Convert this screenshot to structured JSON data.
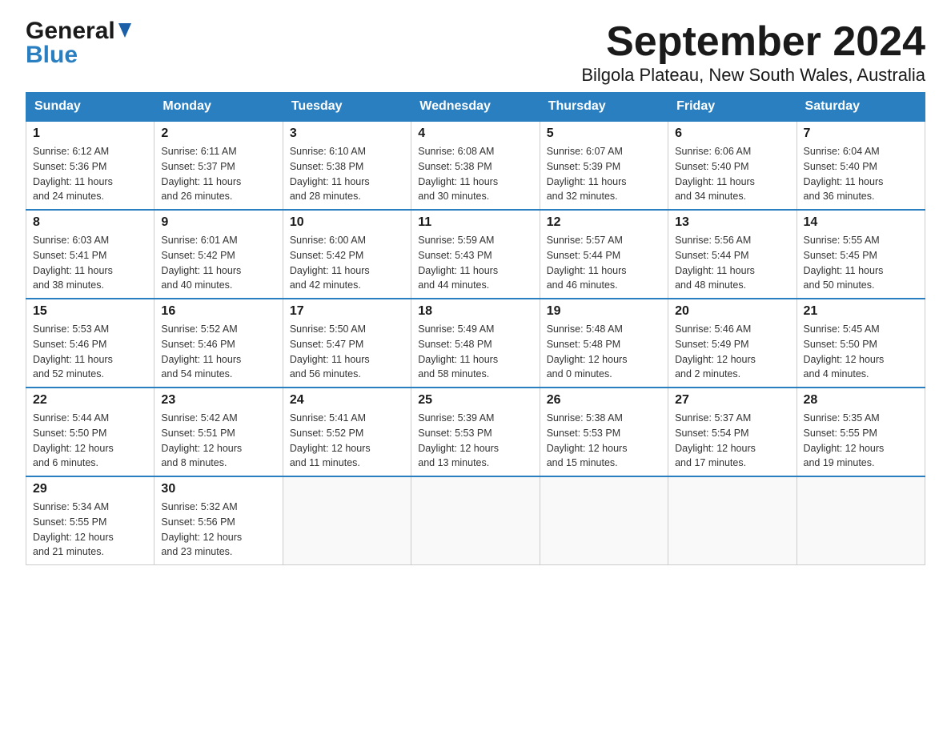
{
  "header": {
    "logo_part1": "General",
    "logo_part2": "Blue",
    "month_title": "September 2024",
    "location": "Bilgola Plateau, New South Wales, Australia"
  },
  "calendar": {
    "days_of_week": [
      "Sunday",
      "Monday",
      "Tuesday",
      "Wednesday",
      "Thursday",
      "Friday",
      "Saturday"
    ],
    "weeks": [
      [
        {
          "day": "1",
          "sunrise": "6:12 AM",
          "sunset": "5:36 PM",
          "daylight": "11 hours and 24 minutes."
        },
        {
          "day": "2",
          "sunrise": "6:11 AM",
          "sunset": "5:37 PM",
          "daylight": "11 hours and 26 minutes."
        },
        {
          "day": "3",
          "sunrise": "6:10 AM",
          "sunset": "5:38 PM",
          "daylight": "11 hours and 28 minutes."
        },
        {
          "day": "4",
          "sunrise": "6:08 AM",
          "sunset": "5:38 PM",
          "daylight": "11 hours and 30 minutes."
        },
        {
          "day": "5",
          "sunrise": "6:07 AM",
          "sunset": "5:39 PM",
          "daylight": "11 hours and 32 minutes."
        },
        {
          "day": "6",
          "sunrise": "6:06 AM",
          "sunset": "5:40 PM",
          "daylight": "11 hours and 34 minutes."
        },
        {
          "day": "7",
          "sunrise": "6:04 AM",
          "sunset": "5:40 PM",
          "daylight": "11 hours and 36 minutes."
        }
      ],
      [
        {
          "day": "8",
          "sunrise": "6:03 AM",
          "sunset": "5:41 PM",
          "daylight": "11 hours and 38 minutes."
        },
        {
          "day": "9",
          "sunrise": "6:01 AM",
          "sunset": "5:42 PM",
          "daylight": "11 hours and 40 minutes."
        },
        {
          "day": "10",
          "sunrise": "6:00 AM",
          "sunset": "5:42 PM",
          "daylight": "11 hours and 42 minutes."
        },
        {
          "day": "11",
          "sunrise": "5:59 AM",
          "sunset": "5:43 PM",
          "daylight": "11 hours and 44 minutes."
        },
        {
          "day": "12",
          "sunrise": "5:57 AM",
          "sunset": "5:44 PM",
          "daylight": "11 hours and 46 minutes."
        },
        {
          "day": "13",
          "sunrise": "5:56 AM",
          "sunset": "5:44 PM",
          "daylight": "11 hours and 48 minutes."
        },
        {
          "day": "14",
          "sunrise": "5:55 AM",
          "sunset": "5:45 PM",
          "daylight": "11 hours and 50 minutes."
        }
      ],
      [
        {
          "day": "15",
          "sunrise": "5:53 AM",
          "sunset": "5:46 PM",
          "daylight": "11 hours and 52 minutes."
        },
        {
          "day": "16",
          "sunrise": "5:52 AM",
          "sunset": "5:46 PM",
          "daylight": "11 hours and 54 minutes."
        },
        {
          "day": "17",
          "sunrise": "5:50 AM",
          "sunset": "5:47 PM",
          "daylight": "11 hours and 56 minutes."
        },
        {
          "day": "18",
          "sunrise": "5:49 AM",
          "sunset": "5:48 PM",
          "daylight": "11 hours and 58 minutes."
        },
        {
          "day": "19",
          "sunrise": "5:48 AM",
          "sunset": "5:48 PM",
          "daylight": "12 hours and 0 minutes."
        },
        {
          "day": "20",
          "sunrise": "5:46 AM",
          "sunset": "5:49 PM",
          "daylight": "12 hours and 2 minutes."
        },
        {
          "day": "21",
          "sunrise": "5:45 AM",
          "sunset": "5:50 PM",
          "daylight": "12 hours and 4 minutes."
        }
      ],
      [
        {
          "day": "22",
          "sunrise": "5:44 AM",
          "sunset": "5:50 PM",
          "daylight": "12 hours and 6 minutes."
        },
        {
          "day": "23",
          "sunrise": "5:42 AM",
          "sunset": "5:51 PM",
          "daylight": "12 hours and 8 minutes."
        },
        {
          "day": "24",
          "sunrise": "5:41 AM",
          "sunset": "5:52 PM",
          "daylight": "12 hours and 11 minutes."
        },
        {
          "day": "25",
          "sunrise": "5:39 AM",
          "sunset": "5:53 PM",
          "daylight": "12 hours and 13 minutes."
        },
        {
          "day": "26",
          "sunrise": "5:38 AM",
          "sunset": "5:53 PM",
          "daylight": "12 hours and 15 minutes."
        },
        {
          "day": "27",
          "sunrise": "5:37 AM",
          "sunset": "5:54 PM",
          "daylight": "12 hours and 17 minutes."
        },
        {
          "day": "28",
          "sunrise": "5:35 AM",
          "sunset": "5:55 PM",
          "daylight": "12 hours and 19 minutes."
        }
      ],
      [
        {
          "day": "29",
          "sunrise": "5:34 AM",
          "sunset": "5:55 PM",
          "daylight": "12 hours and 21 minutes."
        },
        {
          "day": "30",
          "sunrise": "5:32 AM",
          "sunset": "5:56 PM",
          "daylight": "12 hours and 23 minutes."
        },
        null,
        null,
        null,
        null,
        null
      ]
    ],
    "labels": {
      "sunrise": "Sunrise: ",
      "sunset": "Sunset: ",
      "daylight": "Daylight: "
    }
  }
}
